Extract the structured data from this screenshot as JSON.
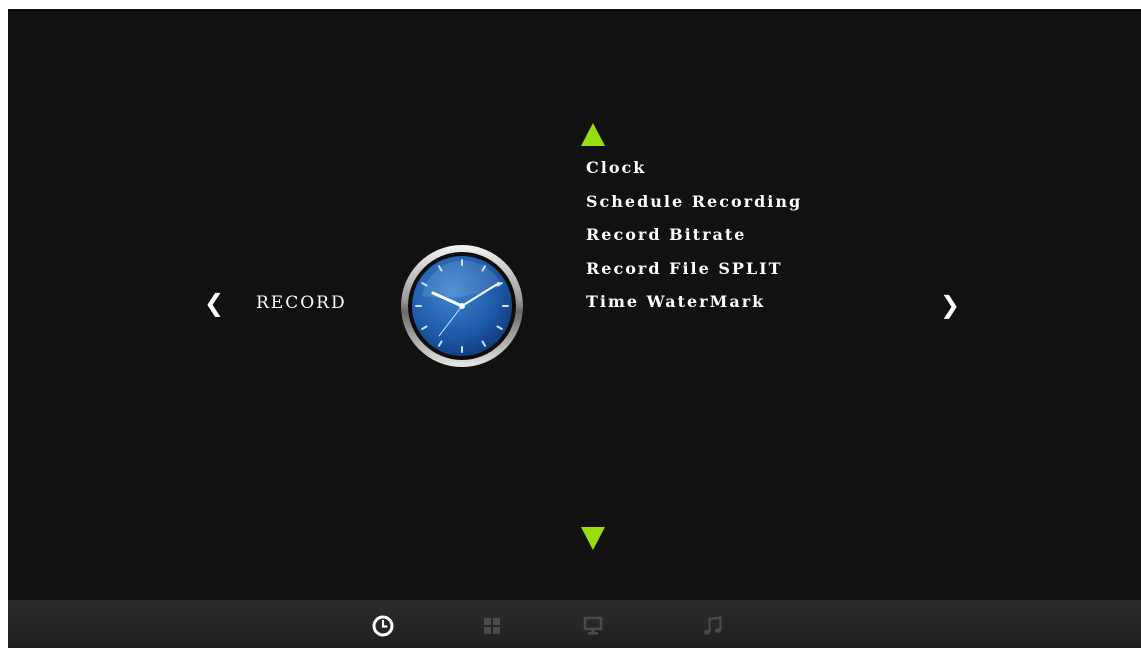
{
  "section": {
    "label": "RECORD",
    "prev_glyph": "❮",
    "next_glyph": "❯"
  },
  "menu": {
    "items": [
      {
        "label": "Clock"
      },
      {
        "label": "Schedule Recording"
      },
      {
        "label": "Record Bitrate"
      },
      {
        "label": "Record File SPLIT"
      },
      {
        "label": "Time WaterMark"
      }
    ]
  },
  "icons": {
    "center": "clock-icon",
    "bottom_bar": [
      "clock-icon",
      "grid-icon",
      "monitor-icon",
      "music-note-icon"
    ]
  },
  "colors": {
    "background": "#111111",
    "accent_arrow": "#99dd10",
    "text": "#ffffff",
    "inactive_icon": "#4a4a4a"
  }
}
